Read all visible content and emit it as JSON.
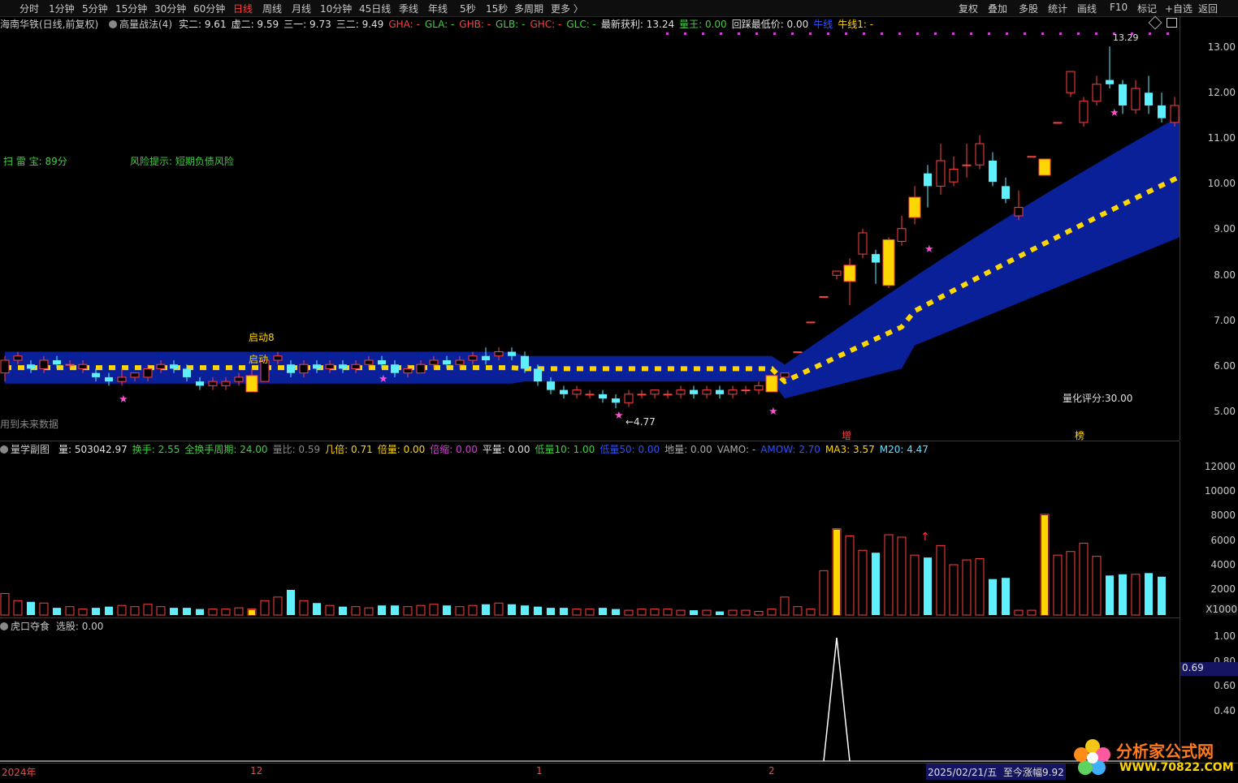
{
  "toolbar": {
    "periods": [
      "分时",
      "1分钟",
      "5分钟",
      "15分钟",
      "30分钟",
      "60分钟",
      "日线",
      "周线",
      "月线",
      "10分钟",
      "45日线",
      "季线",
      "年线",
      "5秒",
      "15秒",
      "多周期",
      "更多 〉"
    ],
    "active_period": "日线",
    "right_items": [
      "复权",
      "叠加",
      "多股",
      "统计",
      "画线",
      "F10",
      "标记",
      "+自选",
      "返回"
    ]
  },
  "info_bar": {
    "stock": "海南华铁(日线,前复权)",
    "indicator": "高量战法(4)",
    "fields": [
      {
        "k": "实二:",
        "v": "9.61",
        "c": "#e0e0e0"
      },
      {
        "k": "虚二:",
        "v": "9.59",
        "c": "#e0e0e0"
      },
      {
        "k": "三一:",
        "v": "9.73",
        "c": "#e0e0e0"
      },
      {
        "k": "三二:",
        "v": "9.49",
        "c": "#e0e0e0"
      },
      {
        "k": "GHA:",
        "v": "-",
        "c": "#ff4040"
      },
      {
        "k": "GLA:",
        "v": "-",
        "c": "#3fd13f"
      },
      {
        "k": "GHB:",
        "v": "-",
        "c": "#ff4040"
      },
      {
        "k": "GLB:",
        "v": "-",
        "c": "#3fd13f"
      },
      {
        "k": "GHC:",
        "v": "-",
        "c": "#ff4040"
      },
      {
        "k": "GLC:",
        "v": "-",
        "c": "#3fd13f"
      },
      {
        "k": "最新获利:",
        "v": "13.24",
        "c": "#e0e0e0"
      },
      {
        "k": "量王:",
        "v": "0.00",
        "c": "#3fd13f"
      },
      {
        "k": "回踩最低价:",
        "v": "0.00",
        "c": "#e0e0e0"
      },
      {
        "k": "牛线",
        "v": "",
        "c": "#3050ff"
      },
      {
        "k": "牛线1:",
        "v": "-",
        "c": "#ffd700"
      }
    ]
  },
  "overlay": {
    "scan_label": "扫 雷 宝:",
    "scan_score": "89分",
    "risk_label": "风险提示:",
    "risk_text": "短期负债风险",
    "start_a": "启动8",
    "start_b": "启动",
    "low_mark": "←4.77",
    "high_mark": "13.29",
    "quant_score": "量化评分:30.00",
    "future_data": "用到未来数据",
    "tag_zeng": "增",
    "tag_bang": "榜"
  },
  "price_axis": [
    "13.00",
    "12.00",
    "11.00",
    "10.00",
    "9.00",
    "8.00",
    "7.00",
    "6.00",
    "5.00"
  ],
  "volume_bar": {
    "name": "量学副图",
    "fields": [
      {
        "k": "量:",
        "v": "503042.97",
        "c": "#e0e0e0"
      },
      {
        "k": "换手:",
        "v": "2.55",
        "c": "#3fd13f"
      },
      {
        "k": "全换手周期:",
        "v": "24.00",
        "c": "#3fd13f"
      },
      {
        "k": "量比:",
        "v": "0.59",
        "c": "#888888"
      },
      {
        "k": "几倍:",
        "v": "0.71",
        "c": "#ffd700"
      },
      {
        "k": "倍量:",
        "v": "0.00",
        "c": "#ffd700"
      },
      {
        "k": "倍缩:",
        "v": "0.00",
        "c": "#d040d0"
      },
      {
        "k": "平量:",
        "v": "0.00",
        "c": "#e0e0e0"
      },
      {
        "k": "低量10:",
        "v": "1.00",
        "c": "#3fd13f"
      },
      {
        "k": "低量50:",
        "v": "0.00",
        "c": "#3050ff"
      },
      {
        "k": "地量:",
        "v": "0.00",
        "c": "#aaaaaa"
      },
      {
        "k": "VAMO:",
        "v": "-",
        "c": "#aaaaaa"
      },
      {
        "k": "AMOW:",
        "v": "2.70",
        "c": "#3050ff"
      },
      {
        "k": "MA3:",
        "v": "3.57",
        "c": "#ffd700"
      },
      {
        "k": "M20:",
        "v": "4.47",
        "c": "#60e0ff"
      }
    ]
  },
  "volume_axis": [
    "12000",
    "10000",
    "8000",
    "6000",
    "4000",
    "2000"
  ],
  "volume_unit": "X1000",
  "indicator_bar": {
    "name": "虎口夺食",
    "field": "选股:",
    "value": "0.00"
  },
  "indicator_axis": [
    "1.00",
    "0.80",
    "0.60",
    "0.40"
  ],
  "indicator_current": "0.69",
  "time_axis": {
    "labels": [
      "2024年",
      "12",
      "1",
      "2"
    ],
    "date": "2025/02/21/五",
    "change": "至今涨幅9.92"
  },
  "watermark": {
    "title": "分析家公式网",
    "url": "WWW.70822.COM"
  },
  "chart_data": {
    "type": "candlestick",
    "price_range": [
      4.6,
      13.6
    ],
    "candles": [
      [
        5.6,
        5.9,
        5.4,
        6.0
      ],
      [
        5.9,
        6.0,
        5.8,
        6.1
      ],
      [
        5.8,
        5.7,
        5.6,
        5.9
      ],
      [
        5.7,
        5.9,
        5.6,
        6.0
      ],
      [
        5.9,
        5.8,
        5.7,
        6.0
      ],
      [
        5.8,
        5.8,
        5.7,
        5.9
      ],
      [
        5.7,
        5.8,
        5.6,
        5.9
      ],
      [
        5.6,
        5.5,
        5.4,
        5.7
      ],
      [
        5.5,
        5.4,
        5.3,
        5.6
      ],
      [
        5.4,
        5.5,
        5.3,
        5.7
      ],
      [
        5.5,
        5.6,
        5.4,
        5.6
      ],
      [
        5.5,
        5.7,
        5.4,
        5.8
      ],
      [
        5.7,
        5.8,
        5.6,
        5.9
      ],
      [
        5.8,
        5.7,
        5.6,
        5.9
      ],
      [
        5.7,
        5.5,
        5.4,
        5.8
      ],
      [
        5.4,
        5.3,
        5.2,
        5.5
      ],
      [
        5.3,
        5.4,
        5.2,
        5.5
      ],
      [
        5.3,
        5.4,
        5.2,
        5.5
      ],
      [
        5.4,
        5.5,
        5.3,
        5.6
      ],
      [
        5.5,
        5.5,
        5.4,
        5.7
      ],
      [
        5.4,
        5.9,
        5.4,
        6.0
      ],
      [
        5.9,
        6.0,
        5.8,
        6.1
      ],
      [
        5.8,
        5.6,
        5.5,
        5.9
      ],
      [
        5.6,
        5.8,
        5.5,
        5.9
      ],
      [
        5.8,
        5.7,
        5.6,
        5.9
      ],
      [
        5.7,
        5.8,
        5.6,
        5.9
      ],
      [
        5.8,
        5.7,
        5.6,
        5.9
      ],
      [
        5.7,
        5.8,
        5.6,
        5.9
      ],
      [
        5.8,
        5.9,
        5.7,
        6.0
      ],
      [
        5.9,
        5.8,
        5.7,
        6.0
      ],
      [
        5.8,
        5.6,
        5.5,
        5.9
      ],
      [
        5.6,
        5.7,
        5.5,
        5.8
      ],
      [
        5.6,
        5.8,
        5.6,
        5.9
      ],
      [
        5.8,
        5.9,
        5.7,
        6.0
      ],
      [
        5.9,
        5.8,
        5.7,
        6.0
      ],
      [
        5.8,
        5.9,
        5.7,
        6.0
      ],
      [
        5.9,
        6.0,
        5.8,
        6.1
      ],
      [
        6.0,
        5.9,
        5.8,
        6.2
      ],
      [
        6.0,
        6.1,
        5.9,
        6.2
      ],
      [
        6.1,
        6.0,
        5.9,
        6.2
      ],
      [
        6.0,
        5.7,
        5.6,
        6.1
      ],
      [
        5.7,
        5.4,
        5.3,
        5.8
      ],
      [
        5.4,
        5.2,
        5.1,
        5.5
      ],
      [
        5.2,
        5.1,
        5.0,
        5.3
      ],
      [
        5.1,
        5.2,
        5.0,
        5.3
      ],
      [
        5.1,
        5.1,
        5.0,
        5.2
      ],
      [
        5.1,
        5.0,
        4.9,
        5.2
      ],
      [
        5.0,
        4.9,
        4.77,
        5.1
      ],
      [
        4.9,
        5.1,
        4.8,
        5.2
      ],
      [
        5.1,
        5.1,
        5.0,
        5.2
      ],
      [
        5.1,
        5.2,
        5.0,
        5.2
      ],
      [
        5.1,
        5.1,
        5.0,
        5.2
      ],
      [
        5.1,
        5.2,
        5.0,
        5.3
      ],
      [
        5.2,
        5.1,
        5.0,
        5.3
      ],
      [
        5.1,
        5.2,
        5.0,
        5.3
      ],
      [
        5.2,
        5.1,
        5.0,
        5.3
      ],
      [
        5.1,
        5.2,
        5.0,
        5.3
      ],
      [
        5.2,
        5.2,
        5.1,
        5.3
      ],
      [
        5.2,
        5.3,
        5.1,
        5.4
      ],
      [
        5.3,
        5.5,
        5.2,
        5.5
      ],
      [
        5.5,
        5.6,
        5.5,
        5.6
      ],
      [
        6.1,
        6.1,
        6.1,
        6.1
      ],
      [
        6.8,
        6.8,
        6.8,
        6.8
      ],
      [
        7.4,
        7.4,
        7.4,
        7.4
      ],
      [
        7.9,
        8.0,
        7.8,
        8.0
      ],
      [
        7.9,
        8.1,
        7.2,
        8.3
      ],
      [
        8.4,
        8.9,
        8.3,
        9.0
      ],
      [
        8.4,
        8.2,
        7.7,
        8.5
      ],
      [
        7.7,
        8.7,
        7.6,
        8.8
      ],
      [
        8.7,
        9.0,
        8.6,
        9.3
      ],
      [
        9.3,
        9.7,
        9.1,
        10.0
      ],
      [
        10.3,
        10.0,
        9.5,
        10.5
      ],
      [
        10.0,
        10.6,
        9.8,
        11.0
      ],
      [
        10.1,
        10.4,
        10.0,
        10.7
      ],
      [
        10.5,
        10.5,
        10.2,
        11.0
      ],
      [
        10.5,
        11.0,
        10.4,
        11.2
      ],
      [
        10.6,
        10.1,
        10.0,
        10.8
      ],
      [
        10.0,
        9.7,
        9.6,
        10.2
      ],
      [
        9.3,
        9.5,
        9.2,
        9.9
      ],
      [
        10.7,
        10.7,
        10.7,
        10.7
      ],
      [
        10.6,
        10.6,
        10.6,
        10.6
      ],
      [
        11.5,
        11.5,
        11.5,
        11.5
      ],
      [
        12.2,
        12.7,
        12.1,
        12.7
      ],
      [
        11.5,
        12.0,
        11.4,
        12.1
      ],
      [
        12.0,
        12.4,
        11.9,
        12.6
      ],
      [
        12.5,
        12.4,
        12.3,
        13.29
      ],
      [
        12.4,
        11.9,
        11.7,
        12.5
      ],
      [
        11.8,
        12.3,
        11.7,
        12.5
      ],
      [
        12.2,
        11.9,
        11.7,
        12.6
      ],
      [
        11.9,
        11.6,
        11.5,
        12.2
      ],
      [
        11.5,
        11.9,
        11.4,
        12.1
      ],
      [
        11.5,
        11.5,
        11.4,
        12.0
      ]
    ],
    "volumes": [
      1.8,
      1.2,
      1.1,
      1.0,
      0.6,
      0.7,
      0.5,
      0.6,
      0.7,
      0.8,
      0.7,
      0.9,
      0.7,
      0.6,
      0.6,
      0.5,
      0.5,
      0.5,
      0.6,
      0.5,
      1.2,
      1.5,
      2.1,
      1.2,
      1.0,
      0.8,
      0.7,
      0.7,
      0.6,
      0.8,
      0.8,
      0.7,
      0.8,
      0.9,
      0.8,
      0.7,
      0.8,
      0.9,
      1.0,
      0.9,
      0.8,
      0.7,
      0.6,
      0.6,
      0.5,
      0.5,
      0.6,
      0.5,
      0.4,
      0.5,
      0.5,
      0.5,
      0.4,
      0.4,
      0.4,
      0.3,
      0.4,
      0.4,
      0.3,
      0.5,
      1.5,
      0.7,
      0.5,
      3.7,
      7.2,
      6.6,
      5.4,
      5.2,
      6.7,
      6.5,
      5.0,
      4.8,
      5.8,
      4.2,
      4.6,
      4.7,
      3.0,
      3.1,
      0.4,
      0.4,
      8.4,
      5.0,
      5.3,
      6.0,
      4.9,
      3.3,
      3.4,
      3.4,
      3.5,
      3.2
    ],
    "indicator_spike_index": 64
  }
}
